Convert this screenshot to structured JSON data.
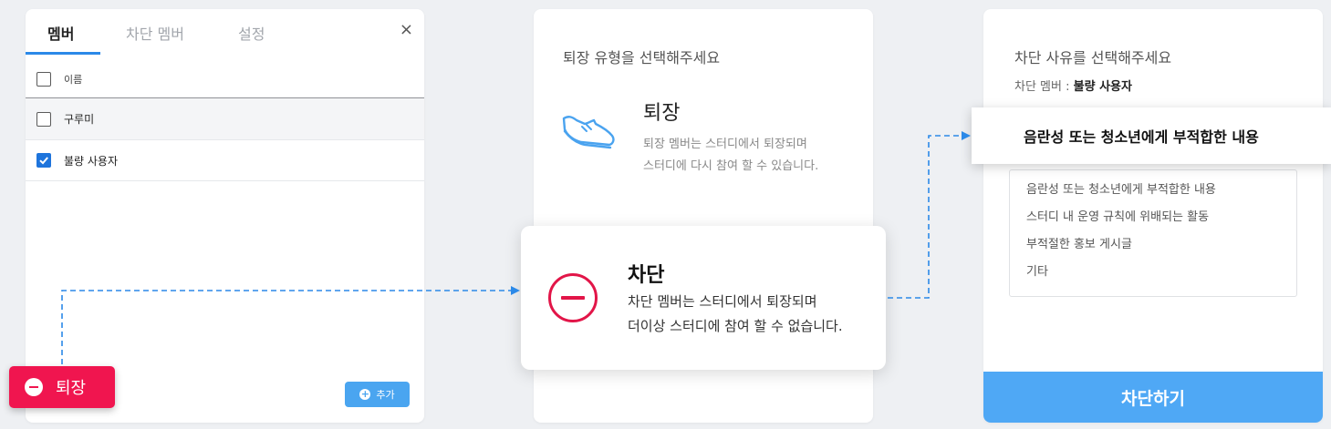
{
  "member_panel": {
    "tabs": [
      "멤버",
      "차단 멤버",
      "설정"
    ],
    "close_icon": "×",
    "header_label": "이름",
    "members": [
      {
        "name": "구루미",
        "checked": false
      },
      {
        "name": "불량 사용자",
        "checked": true
      }
    ],
    "add_label": "추가"
  },
  "exit_button": {
    "label": "퇴장"
  },
  "type_panel": {
    "title": "퇴장 유형을 선택해주세요",
    "exit_option": {
      "title": "퇴장",
      "desc_line1": "퇴장 멤버는 스터디에서 퇴장되며",
      "desc_line2": "스터디에 다시 참여 할 수 있습니다."
    },
    "block_option": {
      "title": "차단",
      "desc_line1": "차단 멤버는 스터디에서 퇴장되며",
      "desc_line2": "더이상 스터디에 참여 할 수 없습니다."
    }
  },
  "reason_panel": {
    "title": "차단 사유를 선택해주세요",
    "member_prefix": "차단 멤버 : ",
    "member_name": "불량 사용자",
    "selected_reason": "음란성 또는 청소년에게 부적합한 내용",
    "reasons": [
      "음란성 또는 청소년에게 부적합한 내용",
      "스터디 내 운영 규칙에 위배되는 활동",
      "부적절한 홍보 게시글",
      "기타"
    ],
    "submit_label": "차단하기"
  },
  "colors": {
    "accent_blue": "#2b89e8",
    "danger": "#f0154f",
    "submit": "#4fa8f5"
  }
}
